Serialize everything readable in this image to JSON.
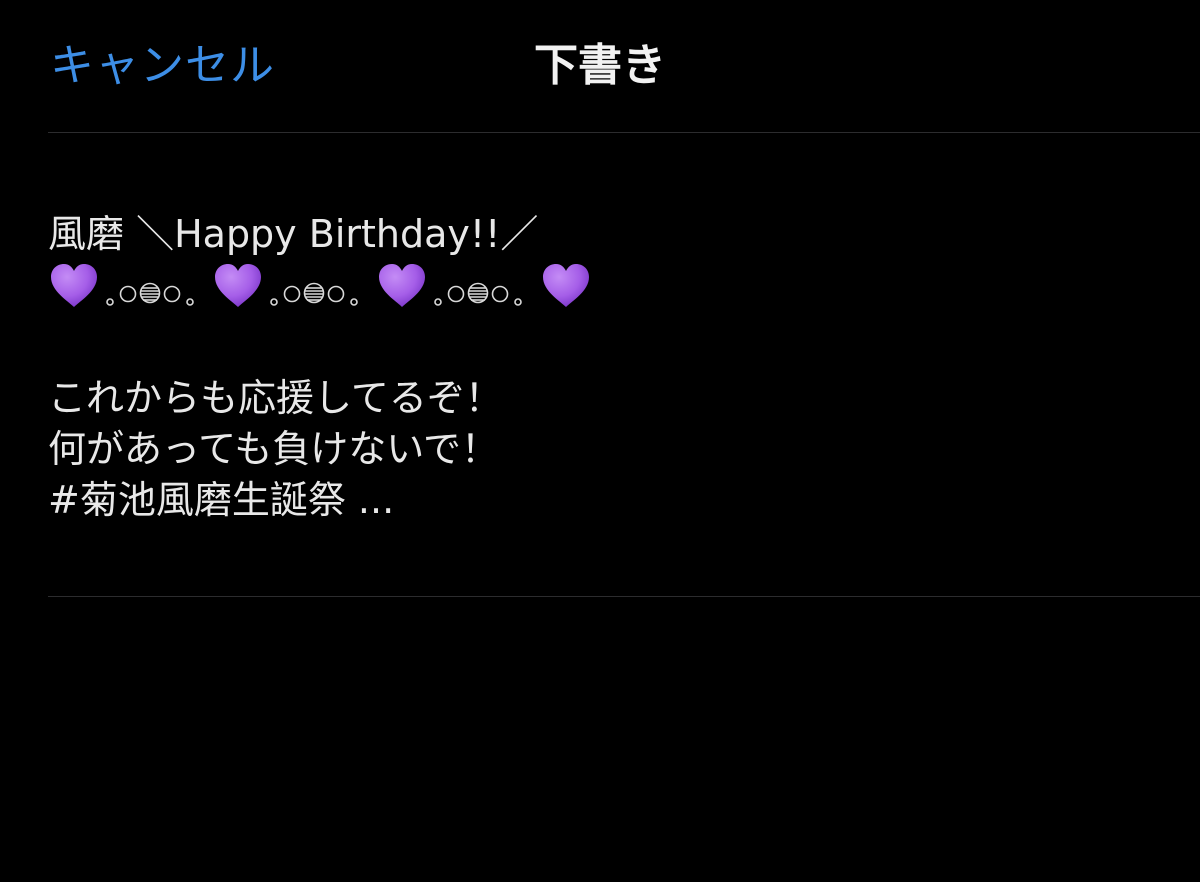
{
  "nav": {
    "cancel_label": "キャンセル",
    "title": "下書き"
  },
  "draft": {
    "line1": "風磨 ＼Happy Birthday!!／",
    "emoji_pattern": [
      "purple-heart",
      "bubbles",
      "purple-heart",
      "bubbles",
      "purple-heart",
      "bubbles",
      "purple-heart"
    ],
    "line3": "これからも応援してるぞ！",
    "line4": "何があっても負けないで！",
    "line5": "#菊池風磨生誕祭 ..."
  },
  "colors": {
    "background": "#000000",
    "accent": "#3d8ee6",
    "text": "#e8e8e8",
    "separator": "#2c2c2e",
    "heart": "#a55ee8"
  }
}
